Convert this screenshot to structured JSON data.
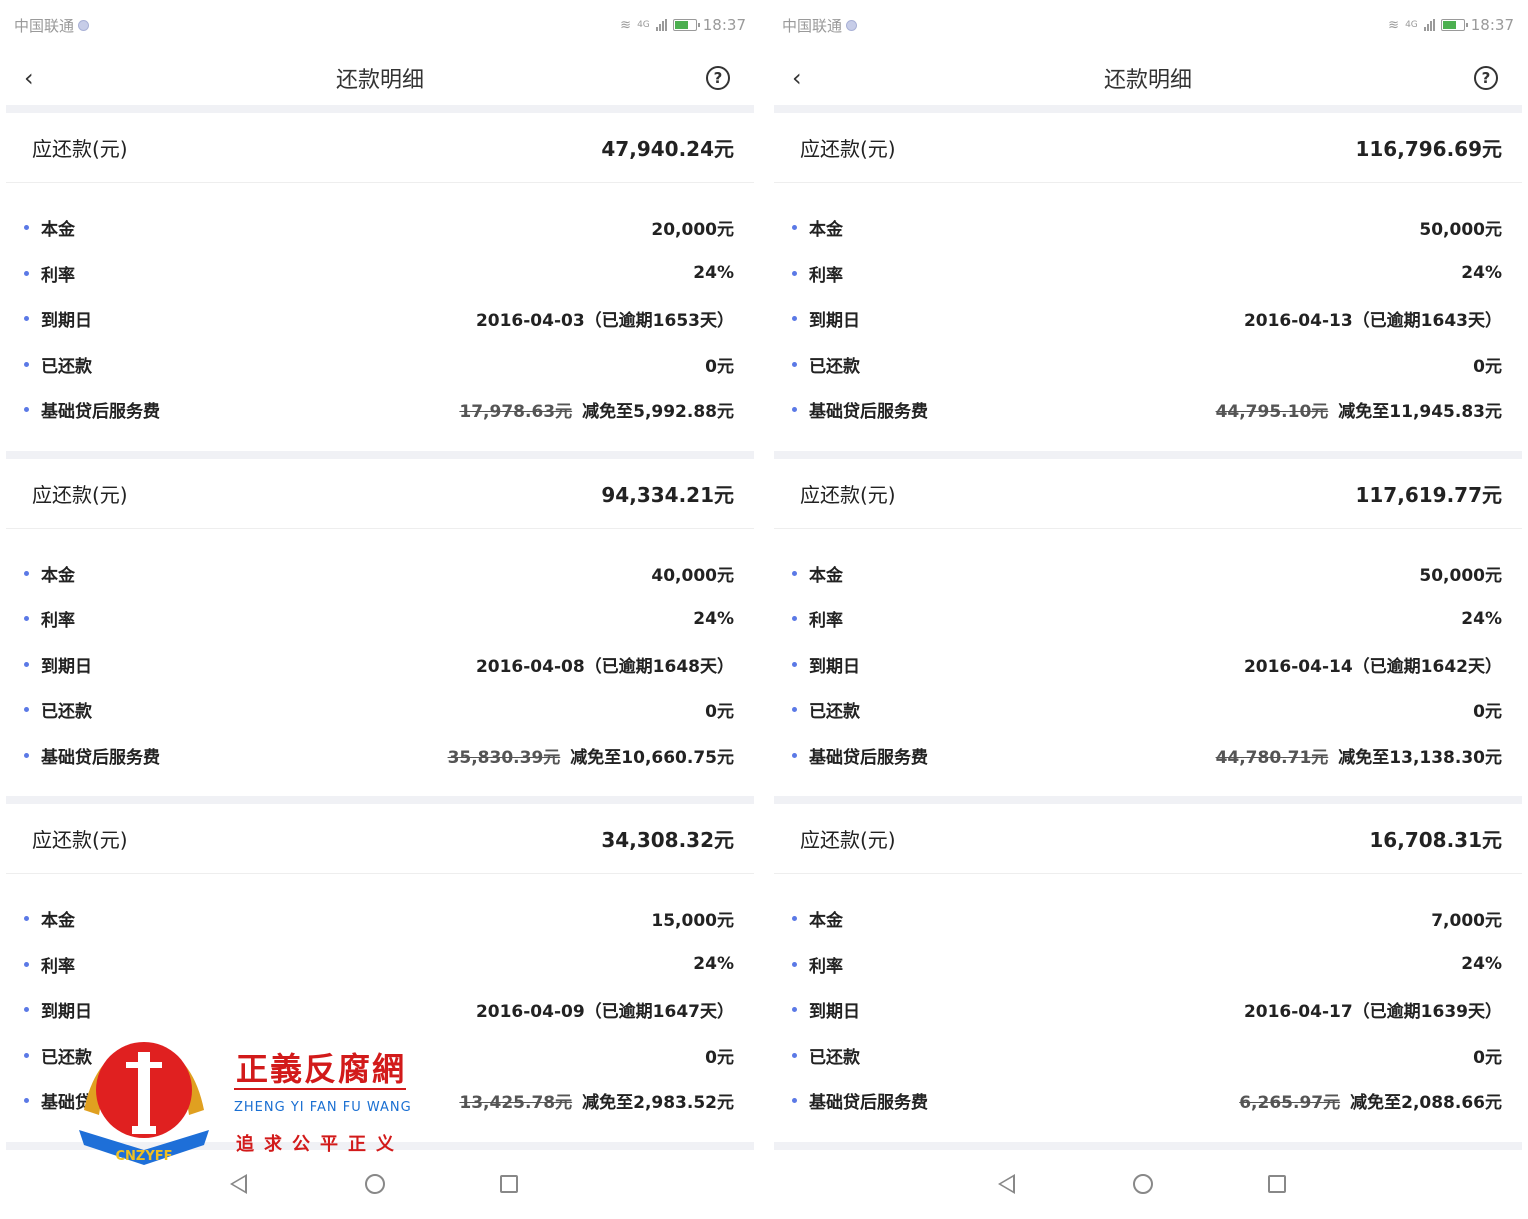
{
  "status": {
    "carrier": "中国联通",
    "network": "4G",
    "time": "18:37"
  },
  "header": {
    "title": "还款明细"
  },
  "labels": {
    "due": "应还款(元)",
    "principal": "本金",
    "rate": "利率",
    "due_date": "到期日",
    "repaid": "已还款",
    "fee": "基础贷后服务费"
  },
  "screens": [
    {
      "cards": [
        {
          "amount": "47,940.24元",
          "principal": "20,000元",
          "rate": "24%",
          "due_date": "2016-04-03（已逾期1653天）",
          "repaid": "0元",
          "fee_old": "17,978.63元",
          "fee_new": "减免至5,992.88元"
        },
        {
          "amount": "94,334.21元",
          "principal": "40,000元",
          "rate": "24%",
          "due_date": "2016-04-08（已逾期1648天）",
          "repaid": "0元",
          "fee_old": "35,830.39元",
          "fee_new": "减免至10,660.75元"
        },
        {
          "amount": "34,308.32元",
          "principal": "15,000元",
          "rate": "24%",
          "due_date": "2016-04-09（已逾期1647天）",
          "repaid": "0元",
          "fee_old": "13,425.78元",
          "fee_new": "减免至2,983.52元"
        }
      ]
    },
    {
      "cards": [
        {
          "amount": "116,796.69元",
          "principal": "50,000元",
          "rate": "24%",
          "due_date": "2016-04-13（已逾期1643天）",
          "repaid": "0元",
          "fee_old": "44,795.10元",
          "fee_new": "减免至11,945.83元"
        },
        {
          "amount": "117,619.77元",
          "principal": "50,000元",
          "rate": "24%",
          "due_date": "2016-04-14（已逾期1642天）",
          "repaid": "0元",
          "fee_old": "44,780.71元",
          "fee_new": "减免至13,138.30元"
        },
        {
          "amount": "16,708.31元",
          "principal": "7,000元",
          "rate": "24%",
          "due_date": "2016-04-17（已逾期1639天）",
          "repaid": "0元",
          "fee_old": "6,265.97元",
          "fee_new": "减免至2,088.66元"
        }
      ]
    }
  ],
  "watermark": {
    "title": "正義反腐網",
    "subtitle": "ZHENG YI FAN FU WANG",
    "slogan": "追求公平正义",
    "emblem_text": "CNZYFF"
  },
  "colors": {
    "accent_dot": "#5b79e6",
    "watermark_red": "#d21a1a",
    "watermark_blue": "#1a6fd2"
  }
}
